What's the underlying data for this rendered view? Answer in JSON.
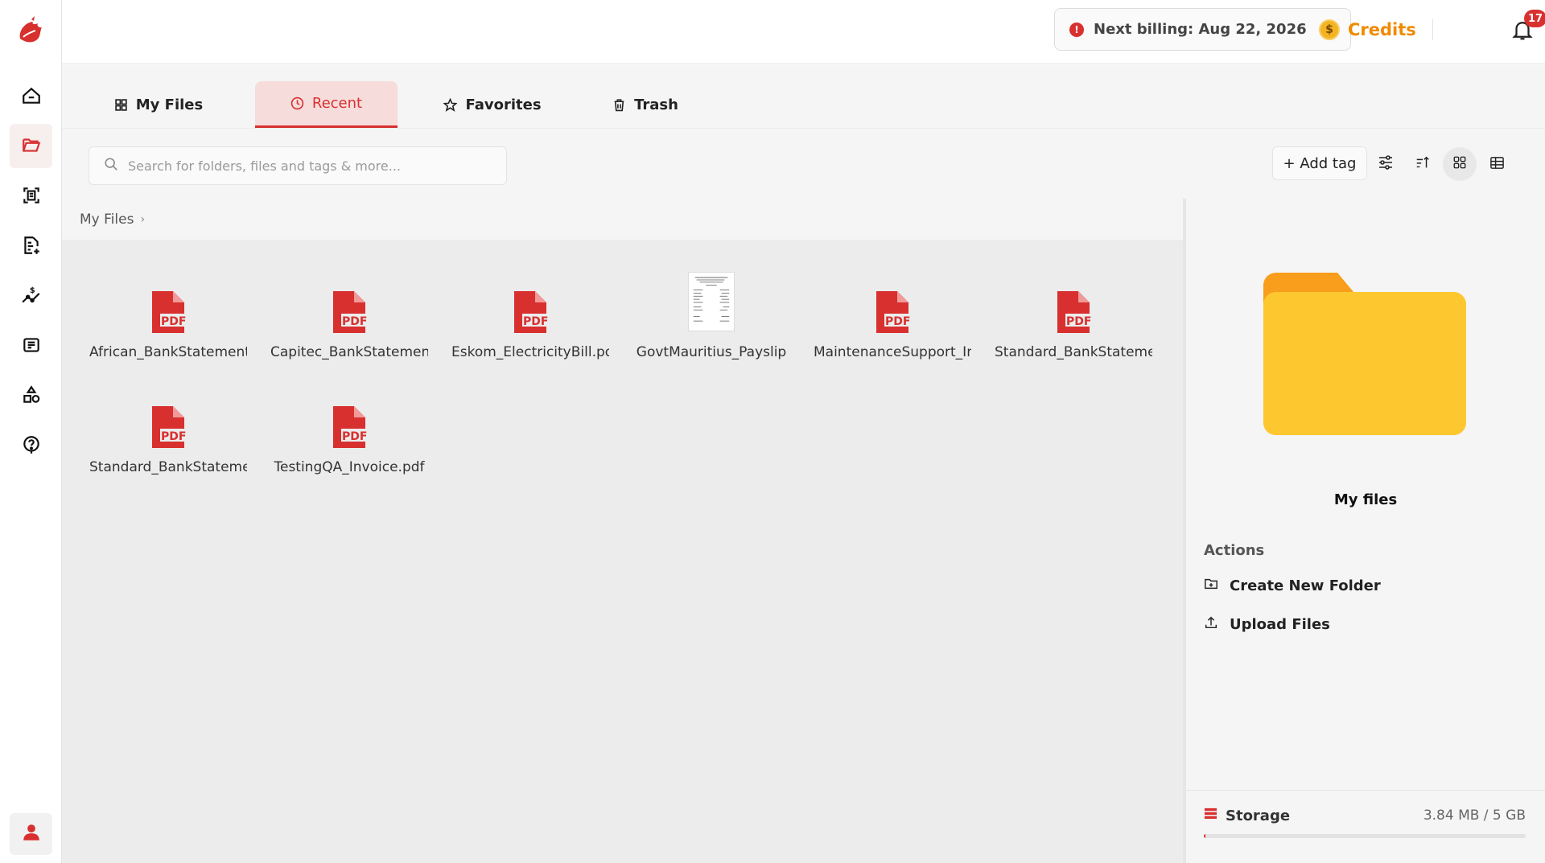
{
  "topbar": {
    "billing_label": "Next billing: Aug 22, 2026",
    "credits_label": "Credits",
    "notification_count": "17"
  },
  "tabs": [
    {
      "label": "My Files",
      "icon": "grid-icon",
      "active": false
    },
    {
      "label": "Recent",
      "icon": "clock-icon",
      "active": true
    },
    {
      "label": "Favorites",
      "icon": "star-icon",
      "active": false
    },
    {
      "label": "Trash",
      "icon": "trash-icon",
      "active": false
    }
  ],
  "search": {
    "placeholder": "Search for folders, files and tags & more..."
  },
  "toolbar": {
    "add_tag_label": "+ Add tag",
    "view_mode": "grid"
  },
  "breadcrumb": {
    "root": "My Files"
  },
  "files": [
    {
      "name": "African_BankStatement.pdf",
      "type": "pdf"
    },
    {
      "name": "Capitec_BankStatement.pdf",
      "type": "pdf"
    },
    {
      "name": "Eskom_ElectricityBill.pdf",
      "type": "pdf"
    },
    {
      "name": "GovtMauritius_Payslip",
      "type": "image"
    },
    {
      "name": "MaintenanceSupport_Invoice.pdf",
      "type": "pdf"
    },
    {
      "name": "Standard_BankStatement.pdf",
      "type": "pdf"
    },
    {
      "name": "Standard_BankStatement.pdf",
      "type": "pdf"
    },
    {
      "name": "TestingQA_Invoice.pdf",
      "type": "pdf"
    }
  ],
  "details": {
    "title": "My files",
    "actions_label": "Actions",
    "actions": [
      "Create New Folder",
      "Upload Files"
    ],
    "storage_label": "Storage",
    "storage_value": "3.84 MB / 5 GB",
    "storage_fraction": 0.0008
  },
  "colors": {
    "accent": "#d7302f",
    "credits": "#f08a00",
    "folder": "#fdc82f"
  }
}
